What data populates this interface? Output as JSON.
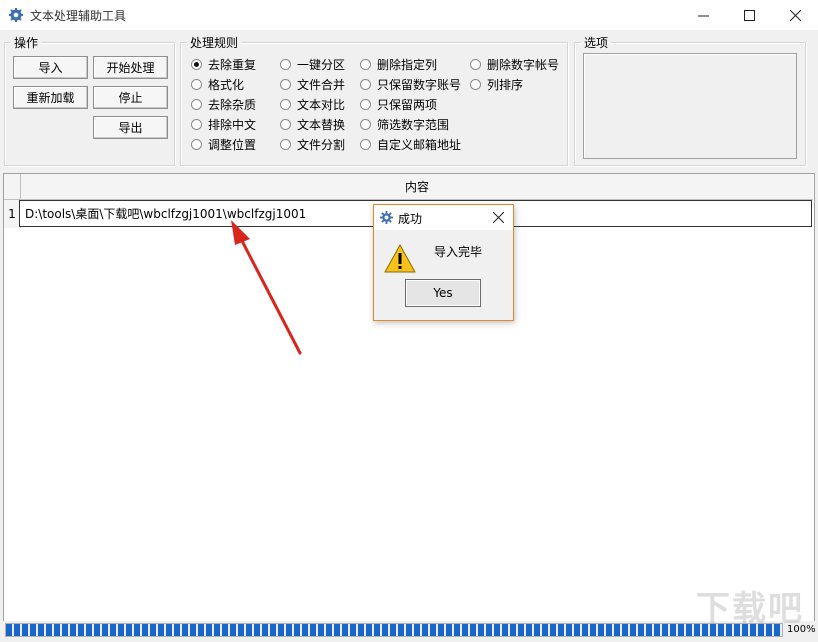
{
  "window": {
    "title": "文本处理辅助工具"
  },
  "ops_group": {
    "title": "操作",
    "import_label": "导入",
    "start_label": "开始处理",
    "reload_label": "重新加载",
    "stop_label": "停止",
    "export_label": "导出"
  },
  "rules_group": {
    "title": "处理规则",
    "options": [
      {
        "label": "去除重复",
        "checked": true
      },
      {
        "label": "格式化",
        "checked": false
      },
      {
        "label": "去除杂质",
        "checked": false
      },
      {
        "label": "排除中文",
        "checked": false
      },
      {
        "label": "调整位置",
        "checked": false
      },
      {
        "label": "一键分区",
        "checked": false
      },
      {
        "label": "文件合并",
        "checked": false
      },
      {
        "label": "文本对比",
        "checked": false
      },
      {
        "label": "文本替换",
        "checked": false
      },
      {
        "label": "文件分割",
        "checked": false
      },
      {
        "label": "删除指定列",
        "checked": false
      },
      {
        "label": "只保留数字账号",
        "checked": false
      },
      {
        "label": "只保留两项",
        "checked": false
      },
      {
        "label": "筛选数字范围",
        "checked": false
      },
      {
        "label": "自定义邮箱地址",
        "checked": false
      },
      {
        "label": "删除数字帐号",
        "checked": false
      },
      {
        "label": "列排序",
        "checked": false
      }
    ]
  },
  "options_group": {
    "title": "选项"
  },
  "grid": {
    "column_header": "内容",
    "rows": [
      {
        "num": "1",
        "content": "D:\\tools\\桌面\\下载吧\\wbclfzgj1001\\wbclfzgj1001"
      }
    ]
  },
  "dialog": {
    "title": "成功",
    "message": "导入完毕",
    "button": "Yes"
  },
  "status": {
    "progress_percent_text": "100%",
    "progress_fraction": 1.0
  },
  "watermark": "下载吧",
  "colors": {
    "progress": "#1a67c9",
    "arrow": "#d9261c",
    "dialog_border": "#e08a2a"
  }
}
